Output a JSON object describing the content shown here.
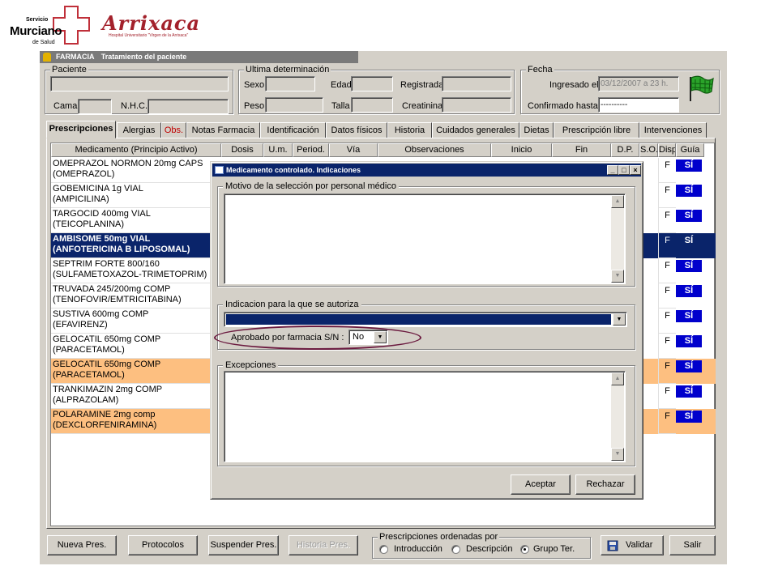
{
  "logos": {
    "sms_line1": "Servicio",
    "sms_line2": "Murciano",
    "sms_line3": "de Salud",
    "arrixaca": "Arrixaca",
    "arrixaca_sub": "Hospital Universitario \"Virgen de la Arrixaca\""
  },
  "window": {
    "app": "FARMACIA",
    "title": "Tratamiento del paciente"
  },
  "paciente": {
    "group_label": "Paciente",
    "cama_label": "Cama",
    "nhc_label": "N.H.C."
  },
  "ultima": {
    "group_label": "Ultima determinación",
    "sexo_label": "Sexo",
    "edad_label": "Edad",
    "registrada_label": "Registrada",
    "peso_label": "Peso",
    "talla_label": "Talla",
    "creatinina_label": "Creatinina"
  },
  "fecha": {
    "group_label": "Fecha",
    "ingresado_label": "Ingresado el",
    "ingresado_value": "03/12/2007 a 23 h.",
    "confirmado_label": "Confirmado hasta",
    "confirmado_value": "----------"
  },
  "tabs": [
    {
      "label": "Prescripciones"
    },
    {
      "label": "Alergias"
    },
    {
      "label": "Obs."
    },
    {
      "label": "Notas Farmacia"
    },
    {
      "label": "Identificación"
    },
    {
      "label": "Datos físicos"
    },
    {
      "label": "Historia"
    },
    {
      "label": "Cuidados generales"
    },
    {
      "label": "Dietas"
    },
    {
      "label": "Prescripción libre"
    },
    {
      "label": "Intervenciones"
    }
  ],
  "grid": {
    "columns": [
      "Medicamento (Principio Activo)",
      "Dosis",
      "U.m.",
      "Period.",
      "Vía",
      "Observaciones",
      "Inicio",
      "Fin",
      "D.P.",
      "S.O.",
      "Disp",
      "Guía"
    ],
    "rows": [
      {
        "line1": "OMEPRAZOL NORMON 20mg CAPS",
        "line2": "(OMEPRAZOL)",
        "disp": "F",
        "guia": "SÍ"
      },
      {
        "line1": "GOBEMICINA 1g VIAL",
        "line2": "(AMPICILINA)",
        "disp": "F",
        "guia": "SÍ"
      },
      {
        "line1": "TARGOCID 400mg VIAL",
        "line2": "(TEICOPLANINA)",
        "disp": "F",
        "guia": "SÍ"
      },
      {
        "line1": "AMBISOME 50mg VIAL",
        "line2": "(ANFOTERICINA B LIPOSOMAL)",
        "disp": "F",
        "guia": "SÍ"
      },
      {
        "line1": "SEPTRIM FORTE 800/160",
        "line2": "(SULFAMETOXAZOL-TRIMETOPRIM)",
        "disp": "F",
        "guia": "SÍ"
      },
      {
        "line1": "TRUVADA 245/200mg COMP",
        "line2": "(TENOFOVIR/EMTRICITABINA)",
        "disp": "F",
        "guia": "SÍ"
      },
      {
        "line1": "SUSTIVA 600mg COMP",
        "line2": "(EFAVIRENZ)",
        "disp": "F",
        "guia": "SÍ"
      },
      {
        "line1": "GELOCATIL 650mg COMP",
        "line2": "(PARACETAMOL)",
        "disp": "F",
        "guia": "SÍ"
      },
      {
        "line1": "GELOCATIL 650mg COMP",
        "line2": "(PARACETAMOL)",
        "disp": "F",
        "guia": "SÍ"
      },
      {
        "line1": "TRANKIMAZIN 2mg COMP",
        "line2": "(ALPRAZOLAM)",
        "disp": "F",
        "guia": "SÍ"
      },
      {
        "line1": "POLARAMINE 2mg comp",
        "line2": "(DEXCLORFENIRAMINA)",
        "disp": "F",
        "guia": "SÍ"
      }
    ]
  },
  "toolbar": {
    "nueva": "Nueva Pres.",
    "protocolos": "Protocolos",
    "suspender": "Suspender Pres.",
    "historia": "Historia Pres.",
    "orden_label": "Prescripciones ordenadas por",
    "opt_intro": "Introducción",
    "opt_desc": "Descripción",
    "opt_grupo": "Grupo Ter.",
    "validar": "Validar",
    "salir": "Salir"
  },
  "dialog": {
    "title": "Medicamento controlado. Indicaciones",
    "motivo_label": "Motivo de la selección por personal médico",
    "indicacion_label": "Indicacion para la que se autoriza",
    "aprobado_label": "Aprobado por farmacia  S/N :",
    "aprobado_value": "No",
    "excepciones_label": "Excepciones",
    "aceptar": "Aceptar",
    "rechazar": "Rechazar"
  },
  "colors": {
    "selected_row": "#0a246a",
    "highlight_row": "#fdbf80",
    "guia_badge": "#0000cc",
    "annotation": "#6b1a3f",
    "brand_red": "#a3212b"
  }
}
